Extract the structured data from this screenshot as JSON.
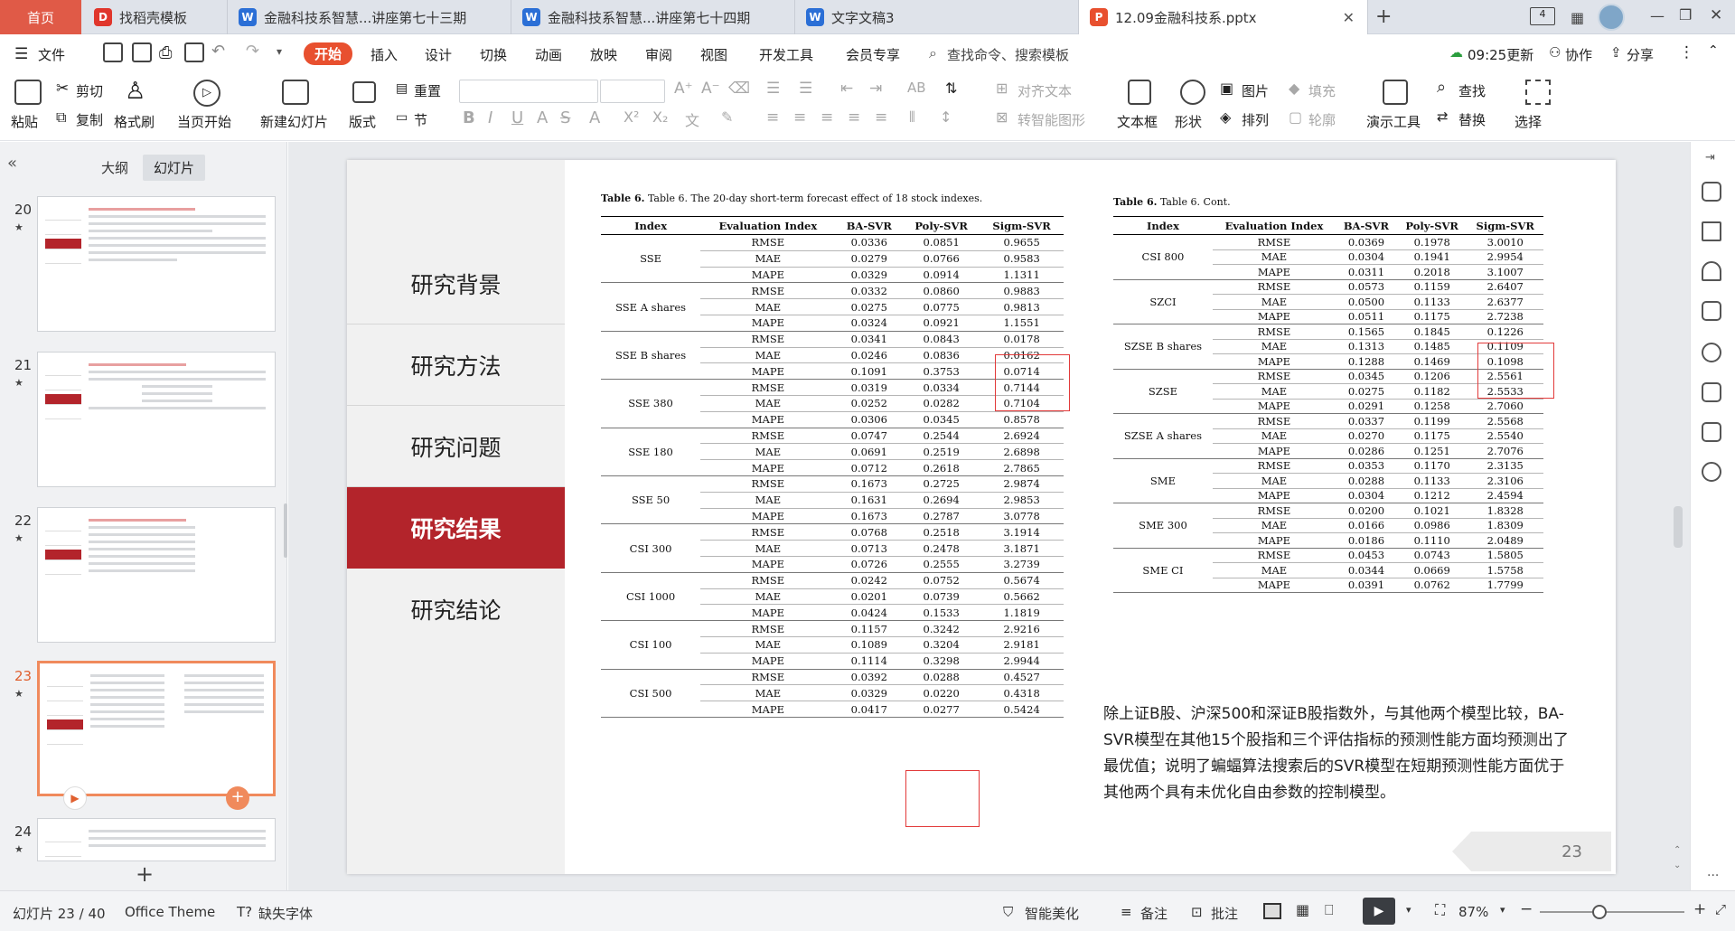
{
  "tabs": {
    "home": "首页",
    "t1": "找稻壳模板",
    "t2": "金融科技系智慧...讲座第七十三期",
    "t3": "金融科技系智慧...讲座第七十四期",
    "t4": "文字文稿3",
    "t5": "12.09金融科技系.pptx"
  },
  "menu": {
    "file": "文件",
    "start": "开始",
    "insert": "插入",
    "design": "设计",
    "switch": "切换",
    "animation": "动画",
    "show": "放映",
    "review": "审阅",
    "view": "视图",
    "dev": "开发工具",
    "member": "会员专享",
    "search": "查找命令、搜索模板",
    "update": "09:25更新",
    "collab": "协作",
    "share": "分享"
  },
  "ribbon": {
    "paste": "粘贴",
    "cut": "剪切",
    "copy": "复制",
    "format_painter": "格式刷",
    "from_current": "当页开始",
    "new_slide": "新建幻灯片",
    "layout": "版式",
    "reset": "重置",
    "section": "节",
    "align_text": "对齐文本",
    "smart_shape": "转智能图形",
    "textbox": "文本框",
    "shape": "形状",
    "picture": "图片",
    "arrange": "排列",
    "fill": "填充",
    "outline": "轮廓",
    "presentation_tool": "演示工具",
    "find": "查找",
    "replace": "替换",
    "select": "选择"
  },
  "panel": {
    "outline": "大纲",
    "slides": "幻灯片",
    "thumbs": [
      "20",
      "21",
      "22",
      "23",
      "24"
    ]
  },
  "slide": {
    "nav": [
      "研究背景",
      "研究方法",
      "研究问题",
      "研究结果",
      "研究结论"
    ],
    "caption_left": "Table 6. The 20-day short-term forecast effect of 18 stock indexes.",
    "caption_right": "Table 6. Cont.",
    "headers": [
      "Index",
      "Evaluation Index",
      "BA-SVR",
      "Poly-SVR",
      "Sigm-SVR"
    ],
    "metrics": [
      "RMSE",
      "MAE",
      "MAPE"
    ],
    "table_left": [
      {
        "index": "SSE",
        "rows": [
          [
            "0.0336",
            "0.0851",
            "0.9655"
          ],
          [
            "0.0279",
            "0.0766",
            "0.9583"
          ],
          [
            "0.0329",
            "0.0914",
            "1.1311"
          ]
        ]
      },
      {
        "index": "SSE A shares",
        "rows": [
          [
            "0.0332",
            "0.0860",
            "0.9883"
          ],
          [
            "0.0275",
            "0.0775",
            "0.9813"
          ],
          [
            "0.0324",
            "0.0921",
            "1.1551"
          ]
        ]
      },
      {
        "index": "SSE B shares",
        "rows": [
          [
            "0.0341",
            "0.0843",
            "0.0178"
          ],
          [
            "0.0246",
            "0.0836",
            "0.0162"
          ],
          [
            "0.1091",
            "0.3753",
            "0.0714"
          ]
        ]
      },
      {
        "index": "SSE 380",
        "rows": [
          [
            "0.0319",
            "0.0334",
            "0.7144"
          ],
          [
            "0.0252",
            "0.0282",
            "0.7104"
          ],
          [
            "0.0306",
            "0.0345",
            "0.8578"
          ]
        ]
      },
      {
        "index": "SSE 180",
        "rows": [
          [
            "0.0747",
            "0.2544",
            "2.6924"
          ],
          [
            "0.0691",
            "0.2519",
            "2.6898"
          ],
          [
            "0.0712",
            "0.2618",
            "2.7865"
          ]
        ]
      },
      {
        "index": "SSE 50",
        "rows": [
          [
            "0.1673",
            "0.2725",
            "2.9874"
          ],
          [
            "0.1631",
            "0.2694",
            "2.9853"
          ],
          [
            "0.1673",
            "0.2787",
            "3.0778"
          ]
        ]
      },
      {
        "index": "CSI 300",
        "rows": [
          [
            "0.0768",
            "0.2518",
            "3.1914"
          ],
          [
            "0.0713",
            "0.2478",
            "3.1871"
          ],
          [
            "0.0726",
            "0.2555",
            "3.2739"
          ]
        ]
      },
      {
        "index": "CSI 1000",
        "rows": [
          [
            "0.0242",
            "0.0752",
            "0.5674"
          ],
          [
            "0.0201",
            "0.0739",
            "0.5662"
          ],
          [
            "0.0424",
            "0.1533",
            "1.1819"
          ]
        ]
      },
      {
        "index": "CSI 100",
        "rows": [
          [
            "0.1157",
            "0.3242",
            "2.9216"
          ],
          [
            "0.1089",
            "0.3204",
            "2.9181"
          ],
          [
            "0.1114",
            "0.3298",
            "2.9944"
          ]
        ]
      },
      {
        "index": "CSI 500",
        "rows": [
          [
            "0.0392",
            "0.0288",
            "0.4527"
          ],
          [
            "0.0329",
            "0.0220",
            "0.4318"
          ],
          [
            "0.0417",
            "0.0277",
            "0.5424"
          ]
        ]
      }
    ],
    "table_right": [
      {
        "index": "CSI 800",
        "rows": [
          [
            "0.0369",
            "0.1978",
            "3.0010"
          ],
          [
            "0.0304",
            "0.1941",
            "2.9954"
          ],
          [
            "0.0311",
            "0.2018",
            "3.1007"
          ]
        ]
      },
      {
        "index": "SZCI",
        "rows": [
          [
            "0.0573",
            "0.1159",
            "2.6407"
          ],
          [
            "0.0500",
            "0.1133",
            "2.6377"
          ],
          [
            "0.0511",
            "0.1175",
            "2.7238"
          ]
        ]
      },
      {
        "index": "SZSE B shares",
        "rows": [
          [
            "0.1565",
            "0.1845",
            "0.1226"
          ],
          [
            "0.1313",
            "0.1485",
            "0.1109"
          ],
          [
            "0.1288",
            "0.1469",
            "0.1098"
          ]
        ]
      },
      {
        "index": "SZSE",
        "rows": [
          [
            "0.0345",
            "0.1206",
            "2.5561"
          ],
          [
            "0.0275",
            "0.1182",
            "2.5533"
          ],
          [
            "0.0291",
            "0.1258",
            "2.7060"
          ]
        ]
      },
      {
        "index": "SZSE A shares",
        "rows": [
          [
            "0.0337",
            "0.1199",
            "2.5568"
          ],
          [
            "0.0270",
            "0.1175",
            "2.5540"
          ],
          [
            "0.0286",
            "0.1251",
            "2.7076"
          ]
        ]
      },
      {
        "index": "SME",
        "rows": [
          [
            "0.0353",
            "0.1170",
            "2.3135"
          ],
          [
            "0.0288",
            "0.1133",
            "2.3106"
          ],
          [
            "0.0304",
            "0.1212",
            "2.4594"
          ]
        ]
      },
      {
        "index": "SME 300",
        "rows": [
          [
            "0.0200",
            "0.1021",
            "1.8328"
          ],
          [
            "0.0166",
            "0.0986",
            "1.8309"
          ],
          [
            "0.0186",
            "0.1110",
            "2.0489"
          ]
        ]
      },
      {
        "index": "SME CI",
        "rows": [
          [
            "0.0453",
            "0.0743",
            "1.5805"
          ],
          [
            "0.0344",
            "0.0669",
            "1.5758"
          ],
          [
            "0.0391",
            "0.0762",
            "1.7799"
          ]
        ]
      }
    ],
    "conclusion": "除上证B股、沪深500和深证B股指数外，与其他两个模型比较，BA-SVR模型在其他15个股指和三个评估指标的预测性能方面均预测出了最优值；说明了蝙蝠算法搜索后的SVR模型在短期预测性能方面优于其他两个具有未优化自由参数的控制模型。",
    "page_number": "23"
  },
  "status": {
    "slide_count": "幻灯片 23 / 40",
    "theme": "Office Theme",
    "missing_font": "缺失字体",
    "beautify": "智能美化",
    "notes": "备注",
    "comments": "批注",
    "zoom": "87%"
  },
  "colors": {
    "accent_red": "#b3242b",
    "home_tab": "#e05a47",
    "start_button": "#e8502f"
  }
}
